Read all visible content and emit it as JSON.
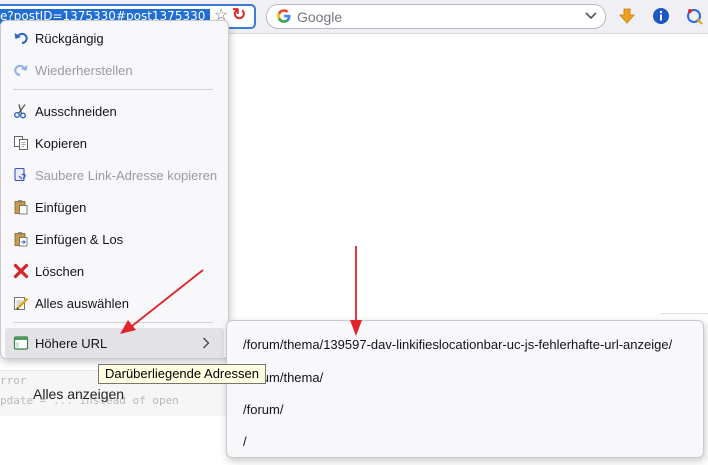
{
  "toolbar": {
    "url_text": "e?postID=1375330#post1375330",
    "search_placeholder": "Google"
  },
  "page": {
    "code_line_1": "rror",
    "code_line_2": "pdate = ... instead of open",
    "show_all": "Alles anzeigen"
  },
  "context_menu": {
    "items": [
      {
        "label": "Rückgängig",
        "icon": "undo-icon",
        "enabled": true
      },
      {
        "label": "Wiederherstellen",
        "icon": "redo-icon",
        "enabled": false
      },
      {
        "label": "Ausschneiden",
        "icon": "scissors-icon",
        "enabled": true
      },
      {
        "label": "Kopieren",
        "icon": "copy-icon",
        "enabled": true
      },
      {
        "label": "Saubere Link-Adresse kopieren",
        "icon": "clean-link-icon",
        "enabled": false
      },
      {
        "label": "Einfügen",
        "icon": "paste-icon",
        "enabled": true
      },
      {
        "label": "Einfügen & Los",
        "icon": "paste-go-icon",
        "enabled": true
      },
      {
        "label": "Löschen",
        "icon": "delete-icon",
        "enabled": true
      },
      {
        "label": "Alles auswählen",
        "icon": "select-all-icon",
        "enabled": true
      },
      {
        "label": "Höhere URL",
        "icon": "window-icon",
        "enabled": true,
        "submenu": true
      }
    ]
  },
  "submenu": {
    "items": [
      "/forum/thema/139597-dav-linkifieslocationbar-uc-js-fehlerhafte-url-anzeige/",
      "/forum/thema/",
      "/forum/",
      "/"
    ]
  },
  "tooltip": {
    "text": "Darüberliegende Adressen"
  },
  "colors": {
    "accent": "#1f6fd6",
    "annotation_arrow": "#e0242b",
    "menu_bg": "#f8f8fa",
    "tooltip_bg": "#ffffe1"
  }
}
